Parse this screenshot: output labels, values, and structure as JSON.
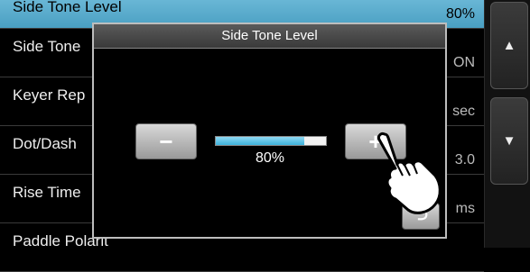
{
  "menu": {
    "items": [
      {
        "label": "Side Tone Level",
        "value": "80%",
        "selected": true
      },
      {
        "label": "Side Tone",
        "value": "ON"
      },
      {
        "label": "Keyer Rep",
        "value": "sec"
      },
      {
        "label": "Dot/Dash",
        "value": "3.0"
      },
      {
        "label": "Rise Time",
        "value": "ms"
      },
      {
        "label": "Paddle Polarit",
        "value": ""
      }
    ]
  },
  "scroll": {
    "up_icon": "triangle-up-icon",
    "down_icon": "triangle-down-icon"
  },
  "dialog": {
    "title": "Side Tone Level",
    "minus_label": "−",
    "plus_label": "+",
    "level_text": "80%",
    "level_fraction": 0.8,
    "back_icon": "return-arrow-icon"
  },
  "colors": {
    "accent": "#5bb5d8",
    "bar_fill": "#3eb2dc"
  }
}
